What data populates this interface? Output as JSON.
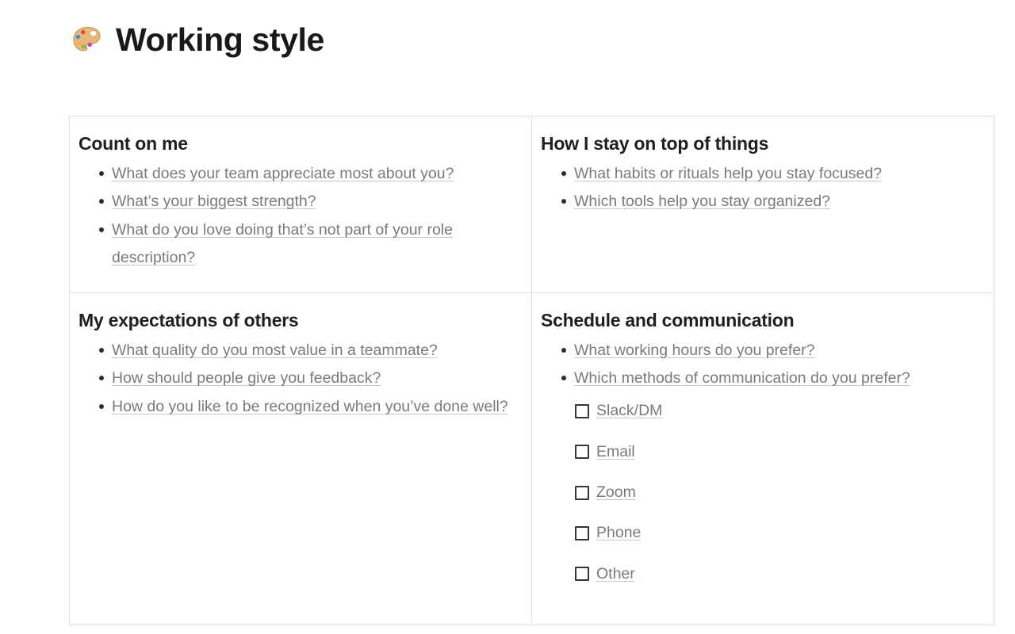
{
  "page": {
    "title": "Working style",
    "title_icon": "palette-emoji",
    "background_color": "#ffffff",
    "heading_color": "#1f1f1e",
    "body_text_color": "#7b7a77",
    "border_color": "#dfdfdd",
    "underline_color": "#c8c7c3"
  },
  "table": {
    "rows": [
      {
        "cells": [
          {
            "heading": "Count on me",
            "items": [
              "What does your team appreciate most about you?",
              "What’s your biggest strength?",
              "What do you love doing that’s not part of your role description?"
            ]
          },
          {
            "heading": "How I stay on top of things",
            "items": [
              "What habits or rituals help you stay focused?",
              "Which tools help you stay organized?"
            ]
          }
        ]
      },
      {
        "cells": [
          {
            "heading": "My expectations of others",
            "items": [
              "What quality do you most value in a teammate?",
              "How should people give you feedback?",
              "How do you like to be recognized when you’ve done well?"
            ]
          },
          {
            "heading": "Schedule and communication",
            "items": [
              "What working hours do you prefer?",
              "Which methods of communication do you prefer?"
            ],
            "checkboxes": [
              {
                "label": "Slack/DM",
                "checked": false
              },
              {
                "label": "Email",
                "checked": false
              },
              {
                "label": "Zoom",
                "checked": false
              },
              {
                "label": "Phone",
                "checked": false
              },
              {
                "label": "Other",
                "checked": false
              }
            ]
          }
        ]
      }
    ]
  }
}
